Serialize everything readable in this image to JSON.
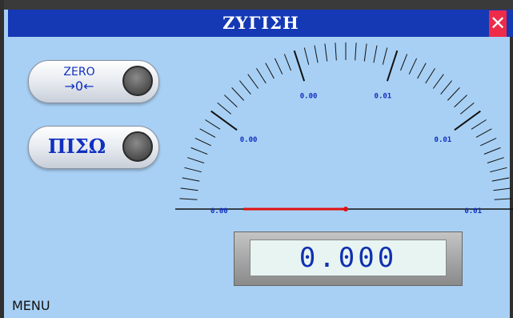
{
  "title": "ΖΥΓΙΣΗ",
  "close_icon": "close-icon",
  "zero_button": {
    "line1": "ZERO",
    "line2": "→0←"
  },
  "back_button": {
    "label": "ΠΙΣΩ"
  },
  "gauge": {
    "labels": [
      "0.00",
      "0.00",
      "0.00",
      "0.01",
      "0.01",
      "0.01"
    ],
    "needle_value": 0,
    "label_color": "#1030c0",
    "needle_color": "#e01010"
  },
  "display": {
    "value": "0.000"
  },
  "menu_label": "MENU",
  "colors": {
    "background": "#a8d0f4",
    "titlebar": "#1538b5",
    "close": "#ee2b49"
  }
}
